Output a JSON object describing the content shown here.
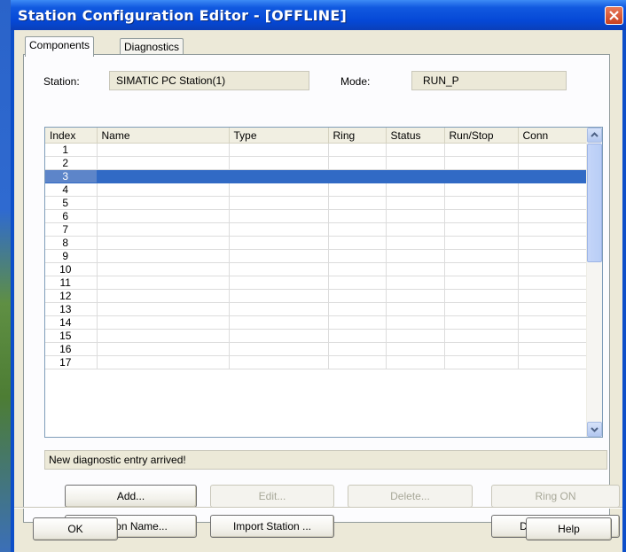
{
  "window": {
    "title": "Station Configuration Editor - [OFFLINE]"
  },
  "tabs": [
    {
      "label": "Components",
      "active": true
    },
    {
      "label": "Diagnostics",
      "active": false
    }
  ],
  "station": {
    "label": "Station:",
    "value": "SIMATIC PC Station(1)"
  },
  "mode": {
    "label": "Mode:",
    "value": "RUN_P"
  },
  "table": {
    "columns": [
      "Index",
      "Name",
      "Type",
      "Ring",
      "Status",
      "Run/Stop",
      "Conn"
    ],
    "rows": [
      {
        "index": "1"
      },
      {
        "index": "2"
      },
      {
        "index": "3",
        "selected": true
      },
      {
        "index": "4"
      },
      {
        "index": "5"
      },
      {
        "index": "6"
      },
      {
        "index": "7"
      },
      {
        "index": "8"
      },
      {
        "index": "9"
      },
      {
        "index": "10"
      },
      {
        "index": "11"
      },
      {
        "index": "12"
      },
      {
        "index": "13"
      },
      {
        "index": "14"
      },
      {
        "index": "15"
      },
      {
        "index": "16"
      },
      {
        "index": "17"
      }
    ]
  },
  "status_message": "New diagnostic entry arrived!",
  "buttons": {
    "add": "Add...",
    "edit": "Edit...",
    "delete": "Delete...",
    "ring_on": "Ring ON",
    "station_name": "Station Name...",
    "import_station": "Import Station ...",
    "disable_station": "Disable Station",
    "ok": "OK",
    "help": "Help"
  },
  "colors": {
    "title_bar": "#0a4fd6",
    "selection": "#316ac5",
    "dialog_bg": "#ece9d8"
  }
}
